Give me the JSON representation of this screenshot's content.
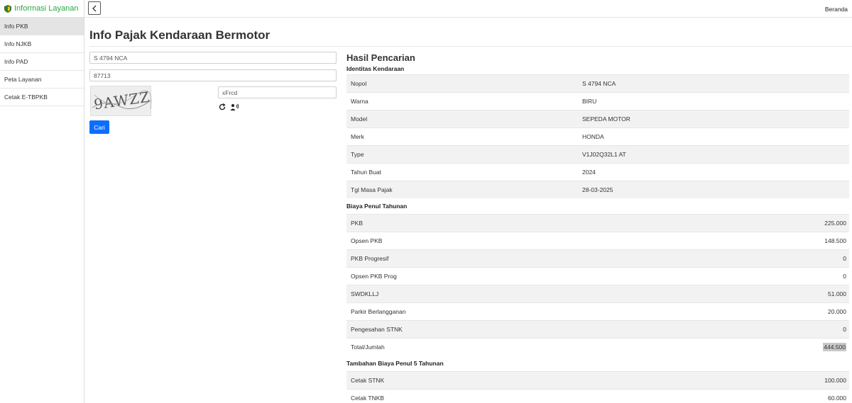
{
  "sidebar": {
    "brand": "Informasi Layanan",
    "items": [
      {
        "label": "Info PKB",
        "active": true
      },
      {
        "label": "Info NJKB"
      },
      {
        "label": "Info PAD"
      },
      {
        "label": "Peta Layanan"
      },
      {
        "label": "Cetak E-TBPKB"
      }
    ]
  },
  "topbar": {
    "right_link": "Beranda"
  },
  "page": {
    "title": "Info Pajak Kendaraan Bermotor"
  },
  "form": {
    "nopol_value": "S 4794 NCA",
    "field2_value": "87713",
    "captcha_image_text": "9AWZZ",
    "captcha_input_value": "xFrcd",
    "submit_label": "Cari"
  },
  "results": {
    "title": "Hasil Pencarian",
    "identitas": {
      "heading": "Identitas Kendaraan",
      "rows": [
        {
          "label": "Nopol",
          "value": "S 4794 NCA"
        },
        {
          "label": "Warna",
          "value": "BIRU"
        },
        {
          "label": "Model",
          "value": "SEPEDA MOTOR"
        },
        {
          "label": "Merk",
          "value": "HONDA"
        },
        {
          "label": "Type",
          "value": "V1J02Q32L1 AT"
        },
        {
          "label": "Tahun Buat",
          "value": "2024"
        },
        {
          "label": "Tgl Masa Pajak",
          "value": "28-03-2025"
        }
      ]
    },
    "biaya": {
      "heading": "Biaya Penul Tahunan",
      "rows": [
        {
          "label": "PKB",
          "value": "225.000"
        },
        {
          "label": "Opsen PKB",
          "value": "148.500"
        },
        {
          "label": "PKB Progresif",
          "value": "0"
        },
        {
          "label": "Opsen PKB Prog",
          "value": "0"
        },
        {
          "label": "SWDKLLJ",
          "value": "51.000"
        },
        {
          "label": "Parkir Berlangganan",
          "value": "20.000"
        },
        {
          "label": "Pengesahan STNK",
          "value": "0"
        },
        {
          "label": "Total/Jumlah",
          "value": "444.500"
        }
      ]
    },
    "tambahan": {
      "heading": "Tambahan Biaya Penul 5 Tahunan",
      "rows": [
        {
          "label": "Cetak STNK",
          "value": "100.000"
        },
        {
          "label": "Cetak TNKB",
          "value": "60.000"
        }
      ]
    }
  },
  "colors": {
    "brand_green": "#28a745",
    "primary_blue": "#0d6efd",
    "row_shade": "#f2f2f2"
  },
  "icons": [
    "shield-icon",
    "chevron-left-icon",
    "refresh-icon",
    "audio-icon"
  ]
}
